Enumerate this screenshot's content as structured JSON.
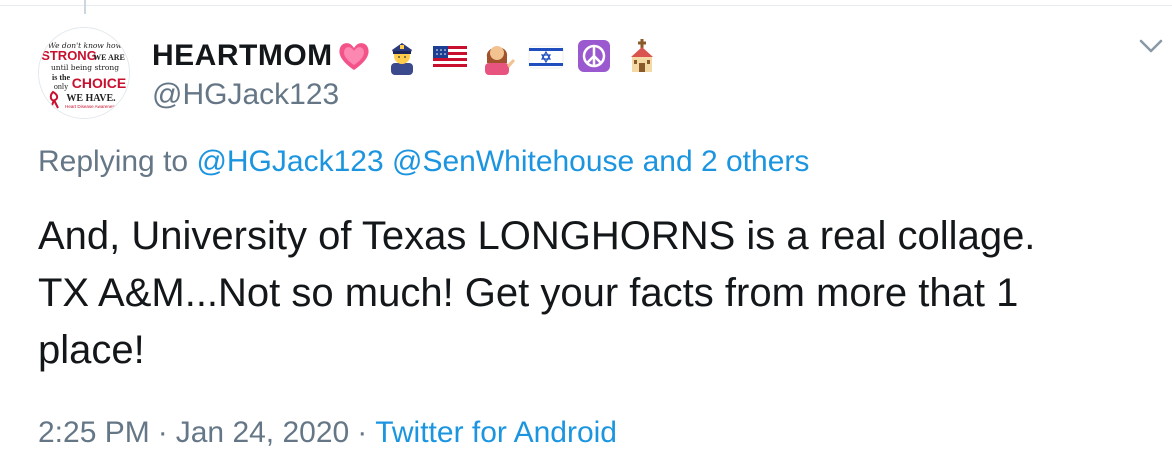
{
  "user": {
    "display_name": "HEARTMOM",
    "handle": "@HGJack123",
    "emojis": [
      "heart-icon",
      "police-officer-icon",
      "us-flag-icon",
      "woman-tipping-hand-icon",
      "israel-flag-icon",
      "peace-symbol-icon",
      "church-icon"
    ],
    "avatar": {
      "line1": "We don't know how",
      "line2": "STRONG",
      "line3": "WE ARE",
      "line4": "until being strong",
      "line5": "is the",
      "line6": "only",
      "line7": "CHOICE",
      "line8": "WE HAVE.",
      "line9": "Heart Disease Awareness"
    }
  },
  "reply": {
    "prefix": "Replying to",
    "mention1": "@HGJack123",
    "mention2": "@SenWhitehouse",
    "others": "and 2 others"
  },
  "tweet": {
    "text": "And, University of Texas LONGHORNS is a real collage.\nTX A&M...Not so much! Get your facts from more that 1\nplace!"
  },
  "meta": {
    "time": "2:25 PM",
    "separator": "·",
    "date": "Jan 24, 2020",
    "source": "Twitter for Android"
  },
  "colors": {
    "link": "#1b95e0",
    "secondary_text": "#657786",
    "primary_text": "#14171a",
    "avatar_red": "#c8102e"
  }
}
